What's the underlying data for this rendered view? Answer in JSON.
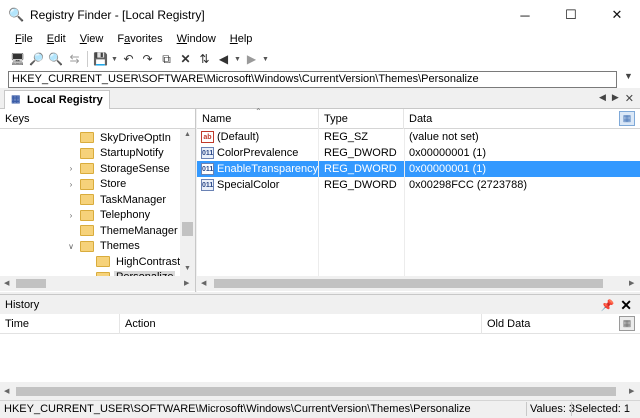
{
  "window": {
    "title": "Registry Finder - [Local Registry]",
    "controls": {
      "minimize": "─",
      "maximize": "☐",
      "close": "✕"
    }
  },
  "menu": [
    {
      "label": "File",
      "mnemonic": "F",
      "rest": "ile"
    },
    {
      "label": "Edit",
      "mnemonic": "E",
      "rest": "dit"
    },
    {
      "label": "View",
      "mnemonic": "V",
      "rest": "iew"
    },
    {
      "label": "Favorites",
      "mnemonic": "a",
      "pre": "F",
      "rest": "vorites"
    },
    {
      "label": "Window",
      "mnemonic": "W",
      "rest": "indow"
    },
    {
      "label": "Help",
      "mnemonic": "H",
      "rest": "elp"
    }
  ],
  "toolbar": {
    "icons": [
      "connect-icon",
      "find-icon",
      "search-icon",
      "replace-icon",
      "save-icon",
      "undo-icon",
      "redo-icon",
      "copy-icon",
      "delete-icon",
      "refresh-icon",
      "back-icon",
      "forward-icon"
    ]
  },
  "address": {
    "value": "HKEY_CURRENT_USER\\SOFTWARE\\Microsoft\\Windows\\CurrentVersion\\Themes\\Personalize"
  },
  "tab": {
    "label": "Local Registry"
  },
  "keys_pane": {
    "header": "Keys",
    "tree": [
      {
        "label": "SkyDriveOptIn",
        "level": 0,
        "expander": ""
      },
      {
        "label": "StartupNotify",
        "level": 0,
        "expander": ""
      },
      {
        "label": "StorageSense",
        "level": 0,
        "expander": ">"
      },
      {
        "label": "Store",
        "level": 0,
        "expander": ">"
      },
      {
        "label": "TaskManager",
        "level": 0,
        "expander": ""
      },
      {
        "label": "Telephony",
        "level": 0,
        "expander": ">"
      },
      {
        "label": "ThemeManager",
        "level": 0,
        "expander": ""
      },
      {
        "label": "Themes",
        "level": 0,
        "expander": "v"
      },
      {
        "label": "HighContrast",
        "level": 1,
        "expander": ""
      },
      {
        "label": "Personalize",
        "level": 1,
        "expander": "",
        "selected": true
      }
    ]
  },
  "values_pane": {
    "columns": {
      "name": "Name",
      "type": "Type",
      "data": "Data"
    },
    "rows": [
      {
        "icon": "ab",
        "name": "(Default)",
        "type": "REG_SZ",
        "data": "(value not set)"
      },
      {
        "icon": "011",
        "name": "ColorPrevalence",
        "type": "REG_DWORD",
        "data": "0x00000001 (1)"
      },
      {
        "icon": "011",
        "name": "EnableTransparency",
        "type": "REG_DWORD",
        "data": "0x00000001 (1)",
        "selected": true
      },
      {
        "icon": "011",
        "name": "SpecialColor",
        "type": "REG_DWORD",
        "data": "0x00298FCC (2723788)"
      }
    ]
  },
  "history": {
    "title": "History",
    "columns": {
      "time": "Time",
      "action": "Action",
      "old_data": "Old Data"
    }
  },
  "status": {
    "path": "HKEY_CURRENT_USER\\SOFTWARE\\Microsoft\\Windows\\CurrentVersion\\Themes\\Personalize",
    "values": "Values: 3",
    "selected": "Selected: 1"
  },
  "colors": {
    "selection": "#3399ff",
    "folder": "#f6d27a"
  }
}
